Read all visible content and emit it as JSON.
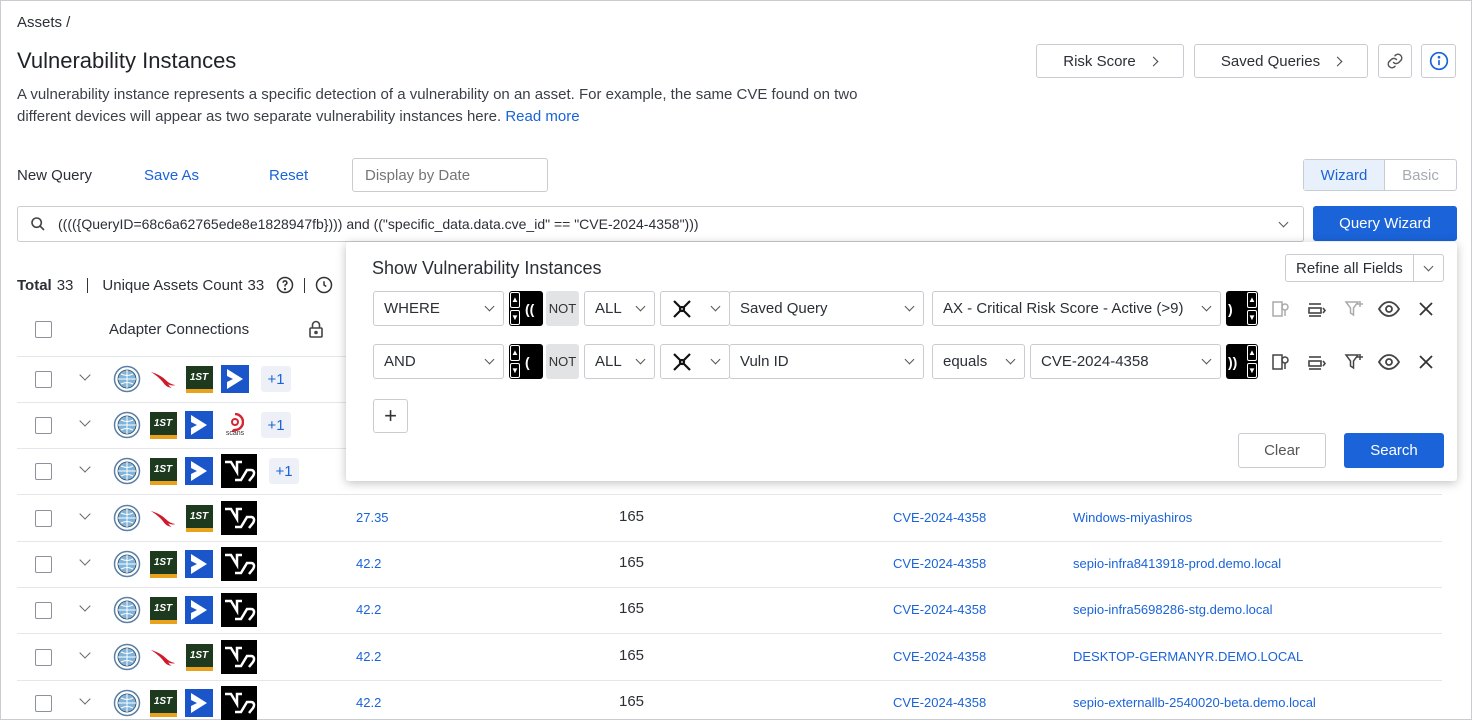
{
  "breadcrumb": "Assets /",
  "page": {
    "title": "Vulnerability Instances",
    "description": "A vulnerability instance represents a specific detection of a vulnerability on an asset. For example, the same CVE found on two different devices will appear as two separate vulnerability instances here.",
    "read_more": "Read more"
  },
  "header_buttons": {
    "risk_score": "Risk Score",
    "saved_queries": "Saved Queries"
  },
  "query_bar": {
    "new_query": "New Query",
    "save_as": "Save As",
    "reset": "Reset",
    "display_by_date_placeholder": "Display by Date",
    "wizard_tab": "Wizard",
    "basic_tab": "Basic",
    "query_text": "(((({QueryID=68c6a62765ede8e1828947fb}))) and ((\"specific_data.data.cve_id\" == \"CVE-2024-4358\")))",
    "query_wizard_button": "Query Wizard"
  },
  "summary": {
    "total_label": "Total",
    "total": "33",
    "unique_label": "Unique Assets Count",
    "unique": "33"
  },
  "table": {
    "header_adapter": "Adapter Connections",
    "rows": [
      {
        "adapters": [
          "globe",
          "crowdstrike",
          "1st",
          "bracket"
        ],
        "extra": "+1",
        "score": "",
        "num": "",
        "cve": "",
        "host": ""
      },
      {
        "adapters": [
          "globe",
          "1st",
          "bracket",
          "qualys"
        ],
        "extra": "+1",
        "score": "",
        "num": "",
        "cve": "",
        "host": ""
      },
      {
        "adapters": [
          "globe",
          "1st",
          "bracket",
          "nvd"
        ],
        "extra": "+1",
        "score": "",
        "num": "",
        "cve": "",
        "host": ""
      },
      {
        "adapters": [
          "globe",
          "crowdstrike",
          "1st",
          "nvd"
        ],
        "extra": "",
        "score": "27.35",
        "num": "165",
        "cve": "CVE-2024-4358",
        "host": "Windows-miyashiros"
      },
      {
        "adapters": [
          "globe",
          "1st",
          "bracket",
          "nvd"
        ],
        "extra": "",
        "score": "42.2",
        "num": "165",
        "cve": "CVE-2024-4358",
        "host": "sepio-infra8413918-prod.demo.local"
      },
      {
        "adapters": [
          "globe",
          "1st",
          "bracket",
          "nvd"
        ],
        "extra": "",
        "score": "42.2",
        "num": "165",
        "cve": "CVE-2024-4358",
        "host": "sepio-infra5698286-stg.demo.local"
      },
      {
        "adapters": [
          "globe",
          "crowdstrike",
          "1st",
          "nvd"
        ],
        "extra": "",
        "score": "42.2",
        "num": "165",
        "cve": "CVE-2024-4358",
        "host": "DESKTOP-GERMANYR.DEMO.LOCAL"
      },
      {
        "adapters": [
          "globe",
          "1st",
          "bracket",
          "nvd"
        ],
        "extra": "",
        "score": "42.2",
        "num": "165",
        "cve": "CVE-2024-4358",
        "host": "sepio-externallb-2540020-beta.demo.local"
      }
    ]
  },
  "wizard": {
    "title": "Show Vulnerability Instances",
    "refine_all_fields": "Refine all Fields",
    "conditions": [
      {
        "logic": "WHERE",
        "open_paren": "((",
        "not": "NOT",
        "scope": "ALL",
        "field": "Saved Query",
        "operator": "",
        "value": "AX - Critical Risk Score - Active (>9)",
        "close_paren": ")"
      },
      {
        "logic": "AND",
        "open_paren": "(",
        "not": "NOT",
        "scope": "ALL",
        "field": "Vuln ID",
        "operator": "equals",
        "value": "CVE-2024-4358",
        "close_paren": "))"
      }
    ],
    "add_label": "+",
    "clear": "Clear",
    "search": "Search"
  },
  "adapter_labels": {
    "qualys_caption": "scans",
    "first_badge": "1ST"
  },
  "colors": {
    "accent": "#1a63d8",
    "link": "#1a63d8",
    "crowdstrike": "#d0192b"
  }
}
